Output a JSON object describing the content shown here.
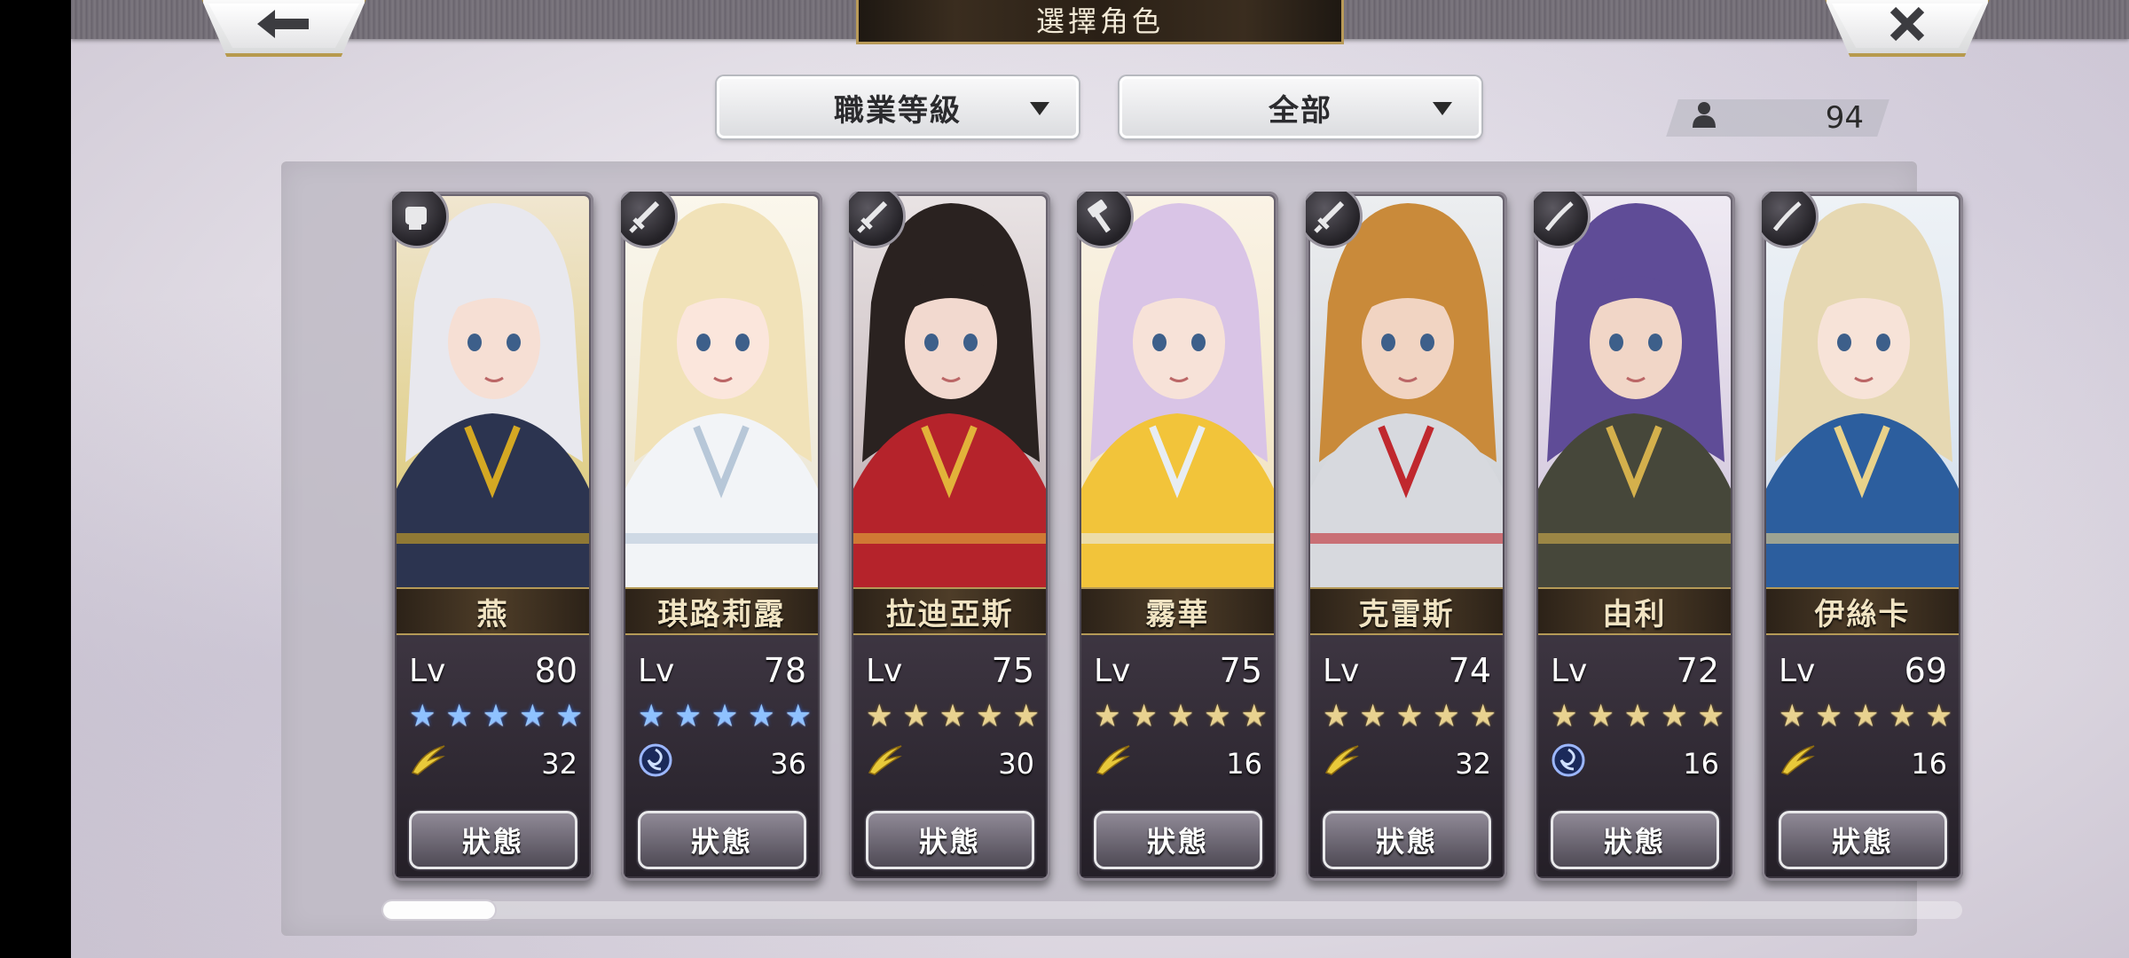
{
  "header": {
    "title": "選擇角色",
    "back_icon": "arrow-left-icon",
    "close_icon": "close-x-icon"
  },
  "filters": {
    "sort_label": "職業等級",
    "filter_label": "全部"
  },
  "character_count": "94",
  "characters": [
    {
      "name": "燕",
      "lv_label": "Lv",
      "level": "80",
      "star_color": "blue",
      "stars": 5,
      "element_icon": "wind-icon",
      "element_value": "32",
      "status_label": "狀態",
      "class_icon": "fist-icon"
    },
    {
      "name": "琪路莉露",
      "lv_label": "Lv",
      "level": "78",
      "star_color": "blue",
      "stars": 5,
      "element_icon": "water-icon",
      "element_value": "36",
      "status_label": "狀態",
      "class_icon": "sword-icon"
    },
    {
      "name": "拉迪亞斯",
      "lv_label": "Lv",
      "level": "75",
      "star_color": "gold",
      "stars": 5,
      "element_icon": "wind-icon",
      "element_value": "30",
      "status_label": "狀態",
      "class_icon": "sword-icon"
    },
    {
      "name": "霧華",
      "lv_label": "Lv",
      "level": "75",
      "star_color": "gold",
      "stars": 5,
      "element_icon": "wind-icon",
      "element_value": "16",
      "status_label": "狀態",
      "class_icon": "hammer-icon"
    },
    {
      "name": "克雷斯",
      "lv_label": "Lv",
      "level": "74",
      "star_color": "gold",
      "stars": 5,
      "element_icon": "wind-icon",
      "element_value": "32",
      "status_label": "狀態",
      "class_icon": "sword-icon"
    },
    {
      "name": "由利",
      "lv_label": "Lv",
      "level": "72",
      "star_color": "gold",
      "stars": 5,
      "element_icon": "water-icon",
      "element_value": "16",
      "status_label": "狀態",
      "class_icon": "katana-icon"
    },
    {
      "name": "伊絲卡",
      "lv_label": "Lv",
      "level": "69",
      "star_color": "gold",
      "stars": 5,
      "element_icon": "wind-icon",
      "element_value": "16",
      "status_label": "狀態",
      "class_icon": "katana-icon"
    }
  ],
  "scroll": {
    "position": 0
  }
}
